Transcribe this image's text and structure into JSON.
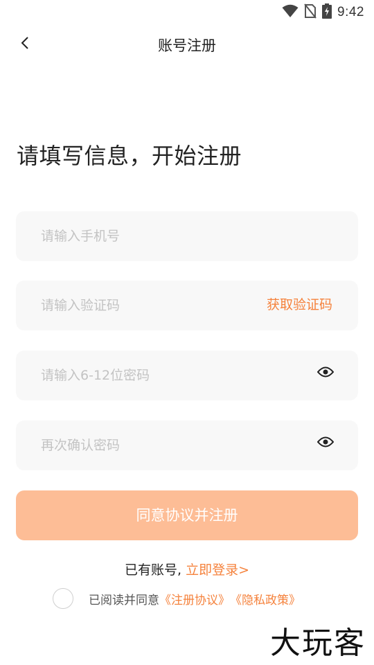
{
  "status_bar": {
    "time": "9:42"
  },
  "nav": {
    "title": "账号注册"
  },
  "headline": "请填写信息，开始注册",
  "fields": {
    "phone_placeholder": "请输入手机号",
    "code_placeholder": "请输入验证码",
    "get_code_label": "获取验证码",
    "password_placeholder": "请输入6-12位密码",
    "confirm_placeholder": "再次确认密码"
  },
  "submit_label": "同意协议并注册",
  "login": {
    "prefix": "已有账号, ",
    "link": "立即登录>"
  },
  "agreement": {
    "text": "已阅读并同意",
    "user_agreement": "《注册协议》",
    "privacy_policy": "《隐私政策》",
    "checked": false
  },
  "watermark": "大玩客",
  "colors": {
    "accent": "#f5823c",
    "button": "#fdbd96",
    "field_bg": "#f8f8f8"
  },
  "icons": [
    "wifi-icon",
    "no-sim-icon",
    "battery-charging-icon",
    "back-arrow-icon",
    "eye-icon"
  ]
}
